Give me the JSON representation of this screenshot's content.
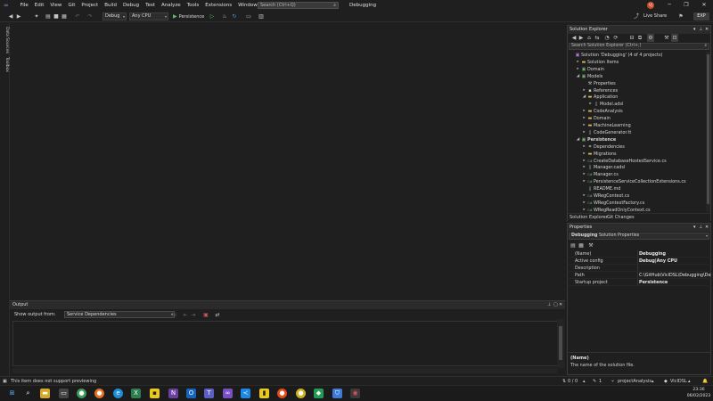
{
  "menubar": {
    "items": [
      "File",
      "Edit",
      "View",
      "Git",
      "Project",
      "Build",
      "Debug",
      "Test",
      "Analyze",
      "Tools",
      "Extensions",
      "Window",
      "Help"
    ],
    "search_placeholder": "Search (Ctrl+Q)",
    "solution_title": "Debugging",
    "avatar_initials": "VJ",
    "live_share": "Live Share",
    "exp_badge": "EXP"
  },
  "toolbar": {
    "config": "Debug",
    "platform": "Any CPU",
    "startup": "Persistence"
  },
  "left_tabs": [
    "Data Sources",
    "Toolbox"
  ],
  "solution_explorer": {
    "title": "Solution Explorer",
    "search_placeholder": "Search Solution Explorer (Ctrl+;)",
    "items": [
      {
        "label": "Solution 'Debugging' (4 of 4 projects)",
        "indent": 0,
        "expander": "",
        "icon": "solution-icon",
        "bold": false
      },
      {
        "label": "Solution Items",
        "indent": 1,
        "expander": "▸",
        "icon": "folder-icon",
        "bold": false
      },
      {
        "label": "Domain",
        "indent": 1,
        "expander": "▸",
        "icon": "project-icon",
        "bold": false
      },
      {
        "label": "Models",
        "indent": 1,
        "expander": "◢",
        "icon": "project-icon",
        "bold": false
      },
      {
        "label": "Properties",
        "indent": 2,
        "expander": "",
        "icon": "wrench-icon",
        "bold": false
      },
      {
        "label": "References",
        "indent": 2,
        "expander": "▸",
        "icon": "references-icon",
        "bold": false
      },
      {
        "label": "Application",
        "indent": 2,
        "expander": "◢",
        "icon": "folder-icon",
        "bold": false
      },
      {
        "label": "Model.adsl",
        "indent": 3,
        "expander": "▸",
        "icon": "file-icon",
        "bold": false
      },
      {
        "label": "CodeAnalysis",
        "indent": 2,
        "expander": "▸",
        "icon": "folder-icon",
        "bold": false
      },
      {
        "label": "Domain",
        "indent": 2,
        "expander": "▸",
        "icon": "folder-icon",
        "bold": false
      },
      {
        "label": "MachineLearning",
        "indent": 2,
        "expander": "▸",
        "icon": "folder-icon",
        "bold": false
      },
      {
        "label": "CodeGenerator.tt",
        "indent": 2,
        "expander": "▸",
        "icon": "file-icon",
        "bold": false
      },
      {
        "label": "Persistence",
        "indent": 1,
        "expander": "◢",
        "icon": "project-icon",
        "bold": true
      },
      {
        "label": "Dependencies",
        "indent": 2,
        "expander": "▸",
        "icon": "dependencies-icon",
        "bold": false
      },
      {
        "label": "Migrations",
        "indent": 2,
        "expander": "▸",
        "icon": "folder-icon",
        "bold": false
      },
      {
        "label": "CreateDatabaseHostedService.cs",
        "indent": 2,
        "expander": "▸",
        "icon": "csharp-icon",
        "bold": false
      },
      {
        "label": "Manager.cadsl",
        "indent": 2,
        "expander": "▸",
        "icon": "file-icon",
        "bold": false
      },
      {
        "label": "Manager.cs",
        "indent": 2,
        "expander": "▸",
        "icon": "csharp-icon",
        "bold": false
      },
      {
        "label": "PersistenceServiceCollectionExtensions.cs",
        "indent": 2,
        "expander": "▸",
        "icon": "csharp-icon",
        "bold": false
      },
      {
        "label": "README.md",
        "indent": 2,
        "expander": "",
        "icon": "file-icon",
        "bold": false
      },
      {
        "label": "WRegContext.cs",
        "indent": 2,
        "expander": "▸",
        "icon": "csharp-icon",
        "bold": false
      },
      {
        "label": "WRegContextFactory.cs",
        "indent": 2,
        "expander": "▸",
        "icon": "csharp-icon",
        "bold": false
      },
      {
        "label": "WRegReadOnlyContext.cs",
        "indent": 2,
        "expander": "▸",
        "icon": "csharp-icon",
        "bold": false
      }
    ],
    "tabs": [
      "Solution Explorer",
      "Git Changes"
    ]
  },
  "properties": {
    "title": "Properties",
    "object_name": "Debugging",
    "object_type": "Solution Properties",
    "rows": [
      {
        "key": "(Name)",
        "value": "Debugging",
        "bold": true
      },
      {
        "key": "Active config",
        "value": "Debug|Any CPU",
        "bold": true
      },
      {
        "key": "Description",
        "value": "",
        "bold": false
      },
      {
        "key": "Path",
        "value": "C:\\GitHub\\VicIDSL\\Debugging\\Debugging.sln",
        "bold": false
      },
      {
        "key": "Startup project",
        "value": "Persistence",
        "bold": true
      }
    ],
    "desc_title": "(Name)",
    "desc_text": "The name of the solution file."
  },
  "output": {
    "title": "Output",
    "show_from_label": "Show output from:",
    "show_from_value": "Service Dependencies"
  },
  "statusbar": {
    "message": "This item does not support previewing",
    "changes": "0 / 0",
    "pencil_count": "1",
    "branch": "projectAnalysis",
    "repo": "VicIDSL"
  },
  "taskbar": {
    "time": "23:36",
    "date": "06/02/2023"
  },
  "colors": {
    "accent": "#b180d7",
    "avatar": "#c94f2b"
  }
}
